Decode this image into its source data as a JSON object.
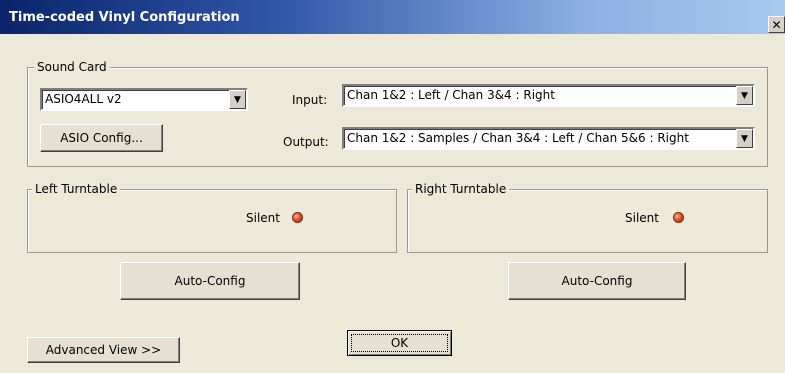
{
  "window": {
    "title": "Time-coded Vinyl Configuration",
    "close_glyph": "✕"
  },
  "sound_card": {
    "legend": "Sound Card",
    "device_value": "ASIO4ALL v2",
    "asio_config_label": "ASIO Config...",
    "input_label": "Input:",
    "input_value": "Chan 1&2 : Left / Chan 3&4 : Right",
    "output_label": "Output:",
    "output_value": "Chan 1&2 : Samples / Chan 3&4 : Left / Chan 5&6 : Right"
  },
  "left_turntable": {
    "legend": "Left Turntable",
    "status": "Silent",
    "auto_config_label": "Auto-Config"
  },
  "right_turntable": {
    "legend": "Right Turntable",
    "status": "Silent",
    "auto_config_label": "Auto-Config"
  },
  "footer": {
    "advanced_view_label": "Advanced View >>",
    "ok_label": "OK"
  },
  "colors": {
    "dialog_bg": "#ece9d8",
    "titlebar_start": "#0a246a",
    "titlebar_end": "#a6caf0",
    "led": "#e05528"
  },
  "icons": {
    "dropdown": "triangle-down-icon",
    "led": "status-led-icon",
    "close": "close-icon"
  }
}
